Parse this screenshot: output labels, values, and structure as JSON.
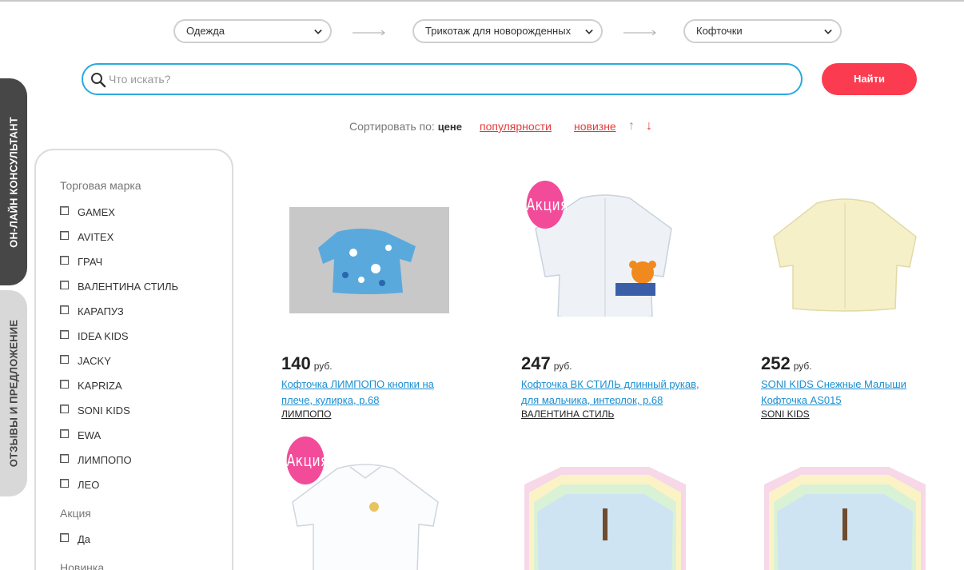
{
  "breadcrumb_selects": [
    {
      "value": "Одежда"
    },
    {
      "value": "Трикотаж для новорожденных"
    },
    {
      "value": "Кофточки"
    }
  ],
  "search": {
    "placeholder": "Что искать?",
    "button_label": "Найти"
  },
  "sort": {
    "label": "Сортировать по:",
    "active": "цене",
    "options": [
      "популярности",
      "новизне"
    ],
    "asc_arrow": "↑",
    "desc_arrow": "↓"
  },
  "side_tabs": {
    "consultant": "ОН-ЛАЙН КОНСУЛЬТАНТ",
    "reviews": "ОТЗЫВЫ И ПРЕДЛОЖЕНИЕ"
  },
  "filters": {
    "brand_title": "Торговая марка",
    "brands": [
      "GAMEX",
      "AVITEX",
      "ГРАЧ",
      "ВАЛЕНТИНА СТИЛЬ",
      "КАРАПУЗ",
      "IDEA KIDS",
      "JACKY",
      "KAPRIZA",
      "SONI KIDS",
      "EWA",
      "ЛИМПОПО",
      "ЛЕО"
    ],
    "promo_title": "Акция",
    "promo_options": [
      "Да"
    ],
    "new_title": "Новинка"
  },
  "promo_badge": "Акция",
  "currency": "руб.",
  "products": [
    {
      "price": "140",
      "name": "Кофточка ЛИМПОПО кнопки на плече, кулирка, р.68",
      "brand": "ЛИМПОПО",
      "promo": false
    },
    {
      "price": "247",
      "name": "Кофточка ВК СТИЛЬ длинный рукав, для мальчика, интерлок, р.68",
      "brand": "ВАЛЕНТИНА СТИЛЬ",
      "promo": true
    },
    {
      "price": "252",
      "name": "SONI KIDS Снежные Малыши Кофточка AS015",
      "brand": "SONI KIDS",
      "promo": false
    },
    {
      "promo": true
    },
    {
      "promo": false
    },
    {
      "promo": false
    }
  ],
  "colors": {
    "accent": "#29a9e0",
    "button": "#fb3b4f",
    "badge": "#f24b9a",
    "link": "#1a8ed1",
    "sort_link": "#e63a3a"
  }
}
